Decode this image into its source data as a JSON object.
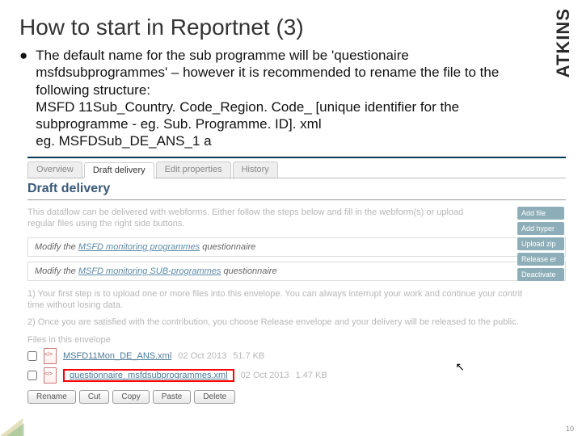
{
  "brand": "ATKINS",
  "title": "How to start in Reportnet (3)",
  "paragraph": "The default name for the sub programme will be 'questionaire msfdsubprogrammes' – however it is recommended to rename the file to the following structure:",
  "filepattern": "MSFD 11Sub_Country. Code_Region. Code_ [unique identifier for the subprogramme - eg. Sub. Programme. ID]. xml",
  "example": "eg. MSFDSub_DE_ANS_1 a",
  "tabs": [
    "Overview",
    "Draft delivery",
    "Edit properties",
    "History"
  ],
  "section": "Draft delivery",
  "desc_a": "This dataflow can be delivered with webforms. Either follow the steps below and fill in the webform(s) or upload",
  "desc_b": "regular files using the right side buttons.",
  "qbox1_pre": "Modify the ",
  "qbox1_link": "MSFD monitoring programmes",
  "qbox1_post": " questionnaire",
  "qbox2_pre": "Modify the ",
  "qbox2_link": "MSFD monitoring SUB-programmes",
  "qbox2_post": " questionnaire",
  "step1": "1) Your first step is to upload one or more files into this envelope. You can always interrupt your work and continue your contrit",
  "step1b": "time without losing data.",
  "step2": "2) Once you are satisfied with the contribution, you choose Release envelope and your delivery will be released to the public.",
  "files_label": "Files in this envelope",
  "file1": {
    "name": "MSFD11Mon_DE_ANS.xml",
    "date": "02 Oct 2013",
    "size": "51.7 KB"
  },
  "file2": {
    "name": "questionnaire_msfdsubprogrammes.xml",
    "date": "02 Oct 2013",
    "size": "1.47 KB"
  },
  "btns": [
    "Rename",
    "Cut",
    "Copy",
    "Paste",
    "Delete"
  ],
  "actions": [
    "Add file",
    "Add hyper",
    "Upload zip",
    "Release er",
    "Deactivate"
  ],
  "pagenum": "10"
}
